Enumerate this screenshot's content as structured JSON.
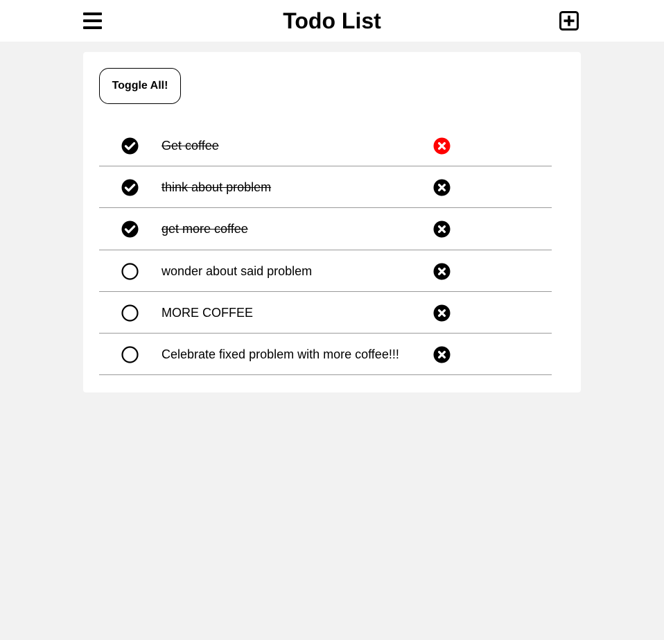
{
  "header": {
    "title": "Todo List",
    "menu_icon": "hamburger-menu-icon",
    "add_icon": "plus-square-icon"
  },
  "toolbar": {
    "toggle_all_label": "Toggle All!"
  },
  "colors": {
    "background": "#f2f2f2",
    "card": "#ffffff",
    "delete_hover": "#ff0000",
    "divider": "#9a9a9a"
  },
  "todos": [
    {
      "text": "Get coffee",
      "completed": true,
      "delete_highlighted": true
    },
    {
      "text": "think about problem",
      "completed": true,
      "delete_highlighted": false
    },
    {
      "text": "get more coffee",
      "completed": true,
      "delete_highlighted": false
    },
    {
      "text": "wonder about said problem",
      "completed": false,
      "delete_highlighted": false
    },
    {
      "text": "MORE COFFEE",
      "completed": false,
      "delete_highlighted": false
    },
    {
      "text": "Celebrate fixed problem with more coffee!!!",
      "completed": false,
      "delete_highlighted": false
    }
  ]
}
